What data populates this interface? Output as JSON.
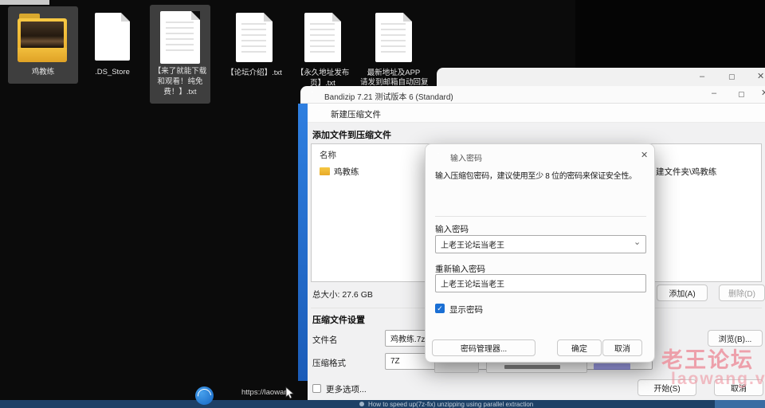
{
  "icons": {
    "minimize": "–",
    "maximize": "▢",
    "close": "✕",
    "chevron_down": "⌄",
    "check": "✓"
  },
  "desktop": {
    "icons": [
      {
        "type": "folder",
        "lines": [
          "鸡教练"
        ]
      },
      {
        "type": "file",
        "lines": [
          ".DS_Store"
        ]
      },
      {
        "type": "file",
        "lines": [
          "【来了就能下载",
          "和观看！纯免",
          "费！】.txt"
        ]
      },
      {
        "type": "file",
        "lines": [
          "【论坛介绍】.txt"
        ]
      },
      {
        "type": "file",
        "lines": [
          "【永久地址发布",
          "页】.txt"
        ]
      },
      {
        "type": "file",
        "lines": [
          "最新地址及APP",
          "请发到邮箱自动回复"
        ]
      }
    ],
    "status_url": "https://laowan"
  },
  "bandizip": {
    "title": "Bandizip 7.21 测试版本 6 (Standard)",
    "new_archive_title": "新建压缩文件",
    "add_section": "添加文件到压缩文件",
    "list": {
      "name_header": "名称",
      "row_name": "鸡教练",
      "row_path_fragment": "建文件夹\\鸡教练"
    },
    "total_size": "总大小: 27.6 GB",
    "settings_section": "压缩文件设置",
    "filename_label": "文件名",
    "filename_value": "鸡教练.7z",
    "format_label": "压缩格式",
    "format_value": "7Z",
    "more_options": "更多选项...",
    "buttons": {
      "add": "添加(A)",
      "delete": "删除(D)",
      "browse": "浏览(B)...",
      "start": "开始(S)",
      "cancel": "取消"
    }
  },
  "password_dialog": {
    "title": "输入密码",
    "description": "输入压缩包密码，建议使用至少 8 位的密码来保证安全性。",
    "input_label": "输入密码",
    "input_value": "上老王论坛当老王",
    "reinput_label": "重新输入密码",
    "reinput_value": "上老王论坛当老王",
    "show_password": "显示密码",
    "buttons": {
      "manager": "密码管理器...",
      "ok": "确定",
      "cancel": "取消"
    }
  },
  "watermark": {
    "line1": "老王论坛",
    "line2": "laowang.vip"
  },
  "taskbar": {
    "video_title": "How to speed up(7z-fix) unzipping using parallel extraction"
  },
  "colors": {
    "accent_blue": "#1a7ad4",
    "watermark_pink": "#ec8c99",
    "taskbar_navy": "#1d4066"
  }
}
